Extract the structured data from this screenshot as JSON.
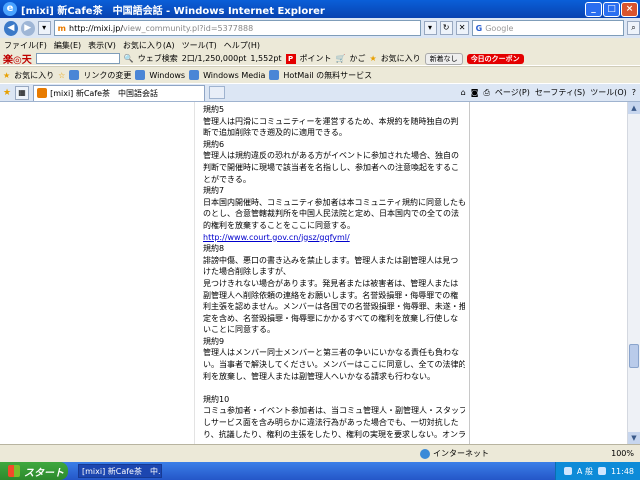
{
  "window": {
    "title": "[mixi] 新Cafe茶　中国語会話 - Windows Internet Explorer",
    "controls": [
      "_",
      "□",
      "×"
    ]
  },
  "address": {
    "url_host": "http://mixi.jp/",
    "url_rest": "view_community.pl?id=5377888",
    "search_placeholder": "Google"
  },
  "menu": [
    "ファイル(F)",
    "編集(E)",
    "表示(V)",
    "お気に入り(A)",
    "ツール(T)",
    "ヘルプ(H)"
  ],
  "toolbar_rakuten": {
    "logo": "楽◎天",
    "web_search": "ウェブ検索",
    "points": "2口/1,250,000pt",
    "pt2": "1,552pt",
    "point_label": "ポイント",
    "cart": "かご",
    "favorites": "お気に入り",
    "badge1": "新着なし",
    "badge2": "今日のクーポン"
  },
  "favorites_bar": [
    "お気に入り",
    "リンクの変更",
    "Windows",
    "Windows Media",
    "HotMail の無料サービス"
  ],
  "tab": {
    "label": "[mixi] 新Cafe茶　中国語会話"
  },
  "command_bar": [
    "ページ(P)",
    "セーフティ(S)",
    "ツール(O)"
  ],
  "content": {
    "lines": [
      "規約5",
      "管理人は円滑にコミュニティーを運営するため、本規約を随時独自の判",
      "断で追加削除でき遡及的に適用できる。",
      "規約6",
      "管理人は規約違反の恐れがある方がイベントに参加された場合、独自の",
      "判断で開催時に現場で該当者を名指しし、参加者への注意喚起をするこ",
      "とができる。",
      "規約7",
      "日本国内開催時、コミュニティ参加者は本コミュニティ規約に同意したも",
      "のとし、合意管轄裁判所を中国人民法院と定め、日本国内での全ての法",
      "的権利を放棄することをここに同意する。"
    ],
    "link": "http://www.court.gov.cn/jgsz/gqfyml/",
    "lines2": [
      "規約8",
      "誹謗中傷、悪口の書き込みを禁止します。管理人または副管理人は見つ",
      "けた場合削除しますが、",
      "見つけきれない場合があります。発見者または被害者は、管理人または",
      "副管理人へ削除依頼の連絡をお願いします。名誉毀損罪・侮辱罪での権",
      "利主張を認めません。メンバーは各国での名誉毀損罪・侮辱罪、未遂・推",
      "定を含め、名誉毀損罪・侮辱罪にかかるすべての権利を放棄し行使しな",
      "いことに同意する。",
      "規約9",
      "管理人はメンバー同士メンバーと第三者の争いにいかなる責任も負わな",
      "い。当事者で解決してください。メンバーはここに同意し、全ての法律的権",
      "利を放棄し、管理人または副管理人へいかなる請求も行わない。",
      "",
      "規約10",
      "コミュ参加者・イベント参加者は、当コミュ管理人・副管理人・スタッフに対",
      "しサービス面を含み明らかに違法行為があった場合でも、一切対抗した",
      "り、抗議したり、権利の主張をしたり、権利の実現を要求しない。オンライ"
    ]
  },
  "status": {
    "zone": "インターネット",
    "zoom": "100%"
  },
  "taskbar": {
    "start": "スタート",
    "item": "[mixi] 新Cafe茶　中...",
    "tray_text": "A 般",
    "clock": "11:48"
  }
}
